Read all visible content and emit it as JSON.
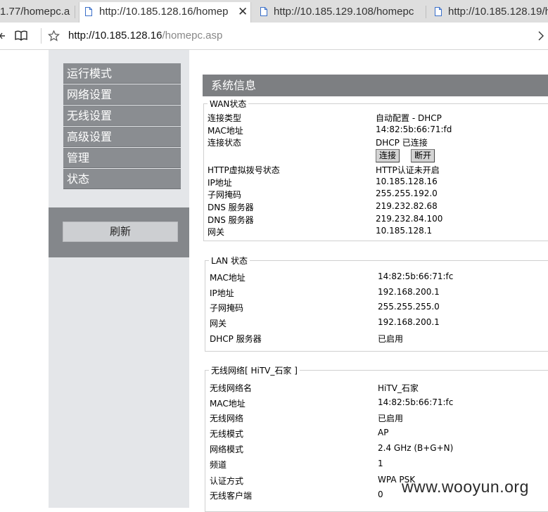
{
  "browser": {
    "tabs": [
      {
        "label": "1.77/homepc.a",
        "active": false
      },
      {
        "label": "http://10.185.128.16/homep",
        "active": true
      },
      {
        "label": "http://10.185.129.108/homepc",
        "active": false
      },
      {
        "label": "http://10.185.128.19/h",
        "active": false
      }
    ],
    "close_glyph": "✕",
    "address_host": "http://10.185.128.16",
    "address_path": "/homepc.asp"
  },
  "nav": {
    "items": [
      "运行模式",
      "网络设置",
      "无线设置",
      "高级设置",
      "管理",
      "状态"
    ],
    "refresh_label": "刷新"
  },
  "system": {
    "title": "系统信息",
    "wan": {
      "legend": "WAN状态",
      "rows": [
        {
          "label": "连接类型",
          "value": "自动配置 - DHCP"
        },
        {
          "label": "MAC地址",
          "value": "14:82:5b:66:71:fd"
        },
        {
          "label": "连接状态",
          "value": "DHCP 已连接"
        },
        {
          "label": "HTTP虚拟拨号状态",
          "value": "HTTP认证未开启"
        },
        {
          "label": "IP地址",
          "value": "10.185.128.16"
        },
        {
          "label": "子网掩码",
          "value": "255.255.192.0"
        },
        {
          "label": "DNS 服务器",
          "value": "219.232.82.68"
        },
        {
          "label": "DNS 服务器",
          "value": "219.232.84.100"
        },
        {
          "label": "网关",
          "value": "10.185.128.1"
        }
      ],
      "connect_label": "连接",
      "disconnect_label": "断开"
    },
    "lan": {
      "legend": "LAN 状态",
      "rows": [
        {
          "label": "MAC地址",
          "value": "14:82:5b:66:71:fc"
        },
        {
          "label": "IP地址",
          "value": "192.168.200.1"
        },
        {
          "label": "子网掩码",
          "value": "255.255.255.0"
        },
        {
          "label": "网关",
          "value": "192.168.200.1"
        },
        {
          "label": "DHCP 服务器",
          "value": "已启用"
        }
      ]
    },
    "wireless": {
      "legend": "无线网络[ HiTV_石家 ]",
      "rows": [
        {
          "label": "无线网络名",
          "value": "HiTV_石家"
        },
        {
          "label": "MAC地址",
          "value": "14:82:5b:66:71:fc"
        },
        {
          "label": "无线网络",
          "value": "已启用"
        },
        {
          "label": "无线模式",
          "value": "AP"
        },
        {
          "label": "网络模式",
          "value": "2.4 GHz (B+G+N)"
        },
        {
          "label": "频道",
          "value": "1"
        },
        {
          "label": "认证方式",
          "value": "WPA PSK"
        },
        {
          "label": "无线客户端",
          "value": "0"
        }
      ]
    }
  },
  "watermark": "www.wooyun.org",
  "colors": {
    "menu_bg": "#8a8d91",
    "panel_bg": "#e4e6e9",
    "header_bg": "#7d7f82",
    "active_tab_bg": "#ffffff",
    "tab_strip_bg": "#dedede"
  }
}
